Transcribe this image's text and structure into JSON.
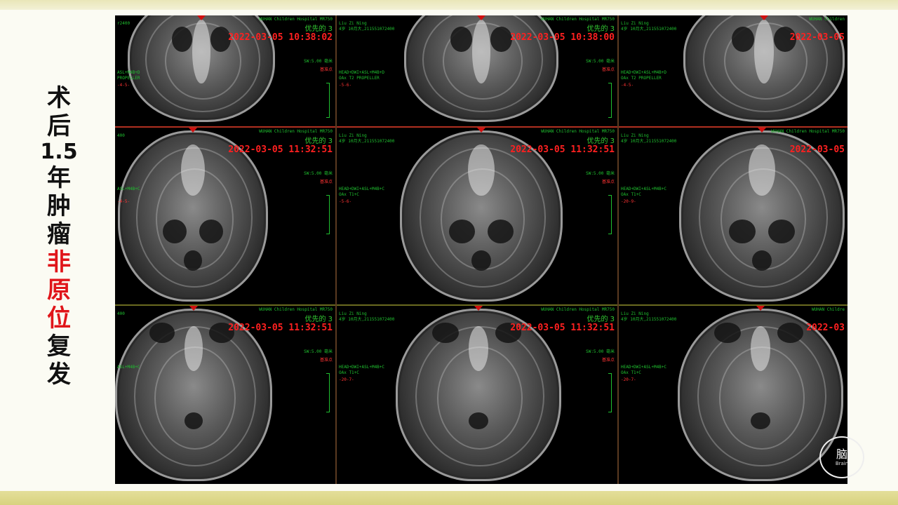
{
  "title": {
    "chars": [
      "术",
      "后",
      "1.5",
      "年",
      "肿",
      "瘤",
      "非",
      "原",
      "位",
      "复",
      "发"
    ],
    "highlight_color": "#e0151a"
  },
  "logo": {
    "text_cn": "脑",
    "text_en": "Brain"
  },
  "rows": [
    {
      "separator_color": "#9ad7e8",
      "cells": [
        {
          "date": "2022-03-05 10:38:02",
          "hospital": "WUHAN Children Hospital MR750",
          "series": "优先的 3",
          "left_top": "r2400",
          "left_mid": "ASL+M4B+D",
          "seq": "PROPELLER",
          "seg": "-4-5-",
          "right_small": "SW:5.00 毫米",
          "tag": "基准点",
          "patient": ""
        },
        {
          "date": "2022-03-05 10:38:00",
          "hospital": "WUHAN Children Hospital MR750",
          "series": "优先的 3",
          "left_top": "Liu Zi Ning",
          "left_mid": "HEAD+DWI+ASL+M4B+D",
          "seq": "OAx T2 PROPELLER",
          "seg": "-5-6-",
          "right_small": "SW:5.00 毫米",
          "tag": "基准点",
          "patient": "4岁 10月大,211551072400"
        },
        {
          "date": "2022-03-05",
          "hospital": "WUHAN Children",
          "series": "",
          "left_top": "Liu Zi Ning",
          "left_mid": "HEAD+DWI+ASL+M4B+D",
          "seq": "OAx T2 PROPELLER",
          "seg": "-4-5-",
          "right_small": "",
          "tag": "",
          "patient": "4岁 10月大,211551072400"
        }
      ]
    },
    {
      "separator_color": "#b03020",
      "cells": [
        {
          "date": "2022-03-05 11:32:51",
          "hospital": "WUHAN Children Hospital MR750",
          "series": "优先的 3",
          "left_top": "400",
          "left_mid": "ASL+M4B+C",
          "seq": "",
          "seg": "-4-5-",
          "right_small": "SW:5.00 毫米",
          "tag": "基准点",
          "patient": ""
        },
        {
          "date": "2022-03-05 11:32:51",
          "hospital": "WUHAN Children Hospital MR750",
          "series": "优先的 3",
          "left_top": "Liu Zi Ning",
          "left_mid": "HEAD+DWI+ASL+M4B+C",
          "seq": "OAx T1+C",
          "seg": "-5-6-",
          "right_small": "SW:5.00 毫米",
          "tag": "基准点",
          "patient": "4岁 10月大,211551072400"
        },
        {
          "date": "2022-03-05",
          "hospital": "WUHAN Children Hospital MR750",
          "series": "",
          "left_top": "Liu Zi Ning",
          "left_mid": "HEAD+DWI+ASL+M4B+C",
          "seq": "OAx T1+C",
          "seg": "-20-9-",
          "right_small": "",
          "tag": "",
          "patient": "4岁 10月大,211551072400"
        }
      ]
    },
    {
      "separator_color": "#6a6a20",
      "cells": [
        {
          "date": "2022-03-05 11:32:51",
          "hospital": "WUHAN Children Hospital MR750",
          "series": "优先的 3",
          "left_top": "400",
          "left_mid": "ASL+M4B+C",
          "seq": "",
          "seg": "",
          "right_small": "SW:5.00 毫米",
          "tag": "基准点",
          "patient": ""
        },
        {
          "date": "2022-03-05 11:32:51",
          "hospital": "WUHAN Children Hospital MR750",
          "series": "优先的 3",
          "left_top": "Liu Zi Ning",
          "left_mid": "HEAD+DWI+ASL+M4B+C",
          "seq": "OAx T1+C",
          "seg": "-20-7-",
          "right_small": "SW:5.00 毫米",
          "tag": "基准点",
          "patient": "4岁 10月大,211551072400"
        },
        {
          "date": "2022-03",
          "hospital": "WUHAN Childre",
          "series": "",
          "left_top": "Liu Zi Ning",
          "left_mid": "HEAD+DWI+ASL+M4B+C",
          "seq": "OAx T1+C",
          "seg": "-20-7-",
          "right_small": "",
          "tag": "",
          "patient": "4岁 10月大,211551072400"
        }
      ]
    }
  ],
  "colors": {
    "overlay_green": "#1fbf2f",
    "overlay_red": "#ff2020",
    "background": "#fbfbf3"
  }
}
